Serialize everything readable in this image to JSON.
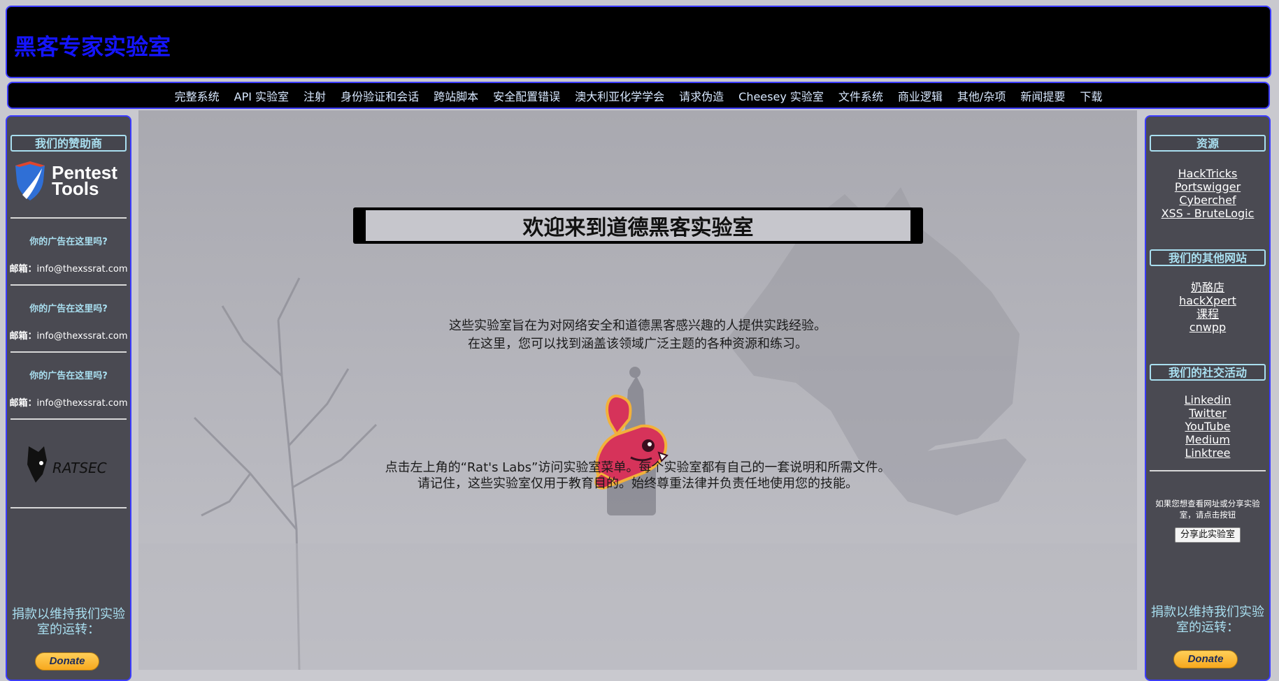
{
  "site_title": "黑客专家实验室",
  "nav": [
    "完整系统",
    "API 实验室",
    "注射",
    "身份验证和会话",
    "跨站脚本",
    "安全配置错误",
    "澳大利亚化学学会",
    "请求伪造",
    "Cheesey 实验室",
    "文件系统",
    "商业逻辑",
    "其他/杂项",
    "新闻提要",
    "下载"
  ],
  "left_sidebar": {
    "sponsors_heading": "我们的赞助商",
    "sponsor_logo_text_1": "Pentest",
    "sponsor_logo_text_2": "Tools",
    "ads": [
      {
        "question": "你的广告在这里吗?",
        "email_label": "邮箱：",
        "email": "info@thexssrat.com"
      },
      {
        "question": "你的广告在这里吗?",
        "email_label": "邮箱：",
        "email": "info@thexssrat.com"
      },
      {
        "question": "你的广告在这里吗?",
        "email_label": "邮箱：",
        "email": "info@thexssrat.com"
      }
    ],
    "ratsec_logo_text": "RATSEC",
    "donate_text": "捐款以维持我们实验室的运转：",
    "donate_button": "Donate"
  },
  "right_sidebar": {
    "resources_heading": "资源",
    "resources": [
      "HackTricks",
      "Portswigger",
      "Cyberchef",
      "XSS - BruteLogic"
    ],
    "other_sites_heading": "我们的其他网站",
    "other_sites": [
      "奶酪店",
      "hackXpert",
      "课程",
      "cnwpp"
    ],
    "social_heading": "我们的社交活动",
    "social": [
      "Linkedin",
      "Twitter",
      "YouTube",
      "Medium",
      "Linktree"
    ],
    "share_text": "如果您想查看网址或分享实验室，请点击按钮",
    "share_button": "分享此实验室",
    "donate_text": "捐款以维持我们实验室的运转：",
    "donate_button": "Donate"
  },
  "main": {
    "welcome": "欢迎来到道德黑客实验室",
    "intro_1": "这些实验室旨在为对网络安全和道德黑客感兴趣的人提供实践经验。",
    "intro_2": "在这里，您可以找到涵盖该领域广泛主题的各种资源和练习。",
    "instr_1": "点击左上角的“Rat's Labs”访问实验室菜单。每个实验室都有自己的一套说明和所需文件。",
    "instr_2": "请记住，这些实验室仅用于教育目的。始终尊重法律并负责任地使用您的技能。"
  },
  "colors": {
    "accent_blue": "#1515ff",
    "heading_cyan": "#a9dff0",
    "sidebar_bg": "#4a4a52"
  }
}
